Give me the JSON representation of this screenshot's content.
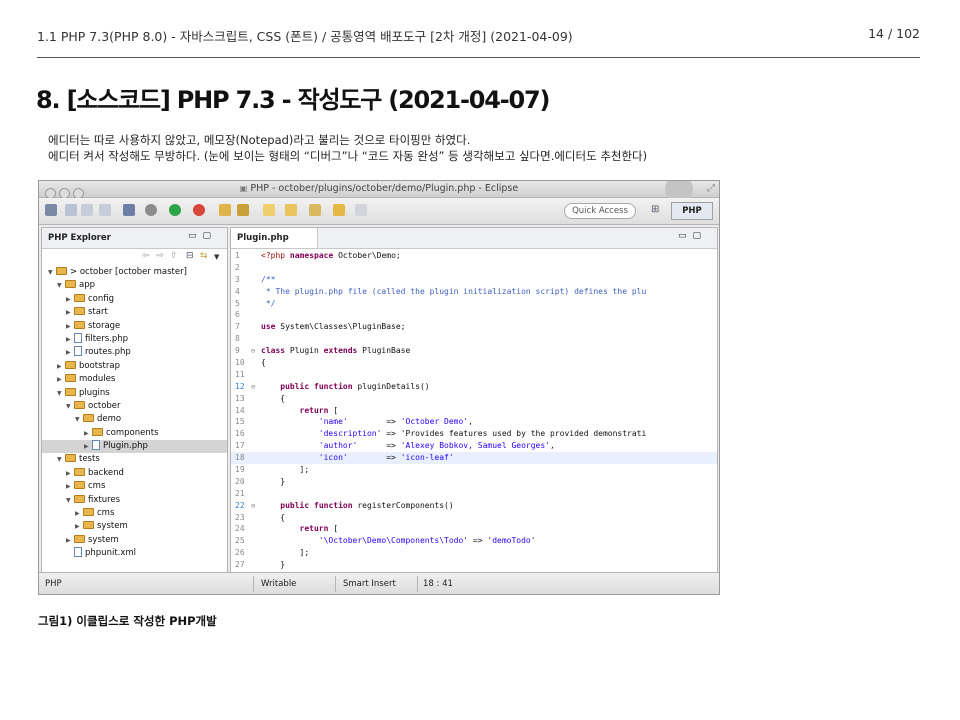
{
  "header": {
    "breadcrumb": "1.1 PHP 7.3(PHP 8.0) - 자바스크립트, CSS (폰트) / 공통영역 배포도구 [2차 개정] (2021-04-09)",
    "page_number": "14 / 102"
  },
  "section_title": "8. [소스코드] PHP 7.3 - 작성도구 (2021-04-07)",
  "description": [
    "에디터는 따로 사용하지 않았고, 메모장(Notepad)라고 불리는 것으로 타이핑만 하였다.",
    "에디터 켜서 작성해도 무방하다. (눈에 보이는 형태의 “디버그”나 “코드 자동 완성” 등 생각해보고 싶다면.에디터도 추천한다)"
  ],
  "caption": "그림1) 이클립스로 작성한 PHP개발",
  "eclipse": {
    "window_title": "PHP - october/plugins/october/demo/Plugin.php - Eclipse",
    "quick_access": "Quick Access",
    "perspective": "PHP",
    "explorer_title": "PHP Explorer",
    "editor_tab": "Plugin.php",
    "tree": [
      {
        "label": "> october  [october master]",
        "depth": 0,
        "kind": "project",
        "open": true
      },
      {
        "label": "app",
        "depth": 1,
        "kind": "folder",
        "open": true
      },
      {
        "label": "config",
        "depth": 2,
        "kind": "folder",
        "open": false
      },
      {
        "label": "start",
        "depth": 2,
        "kind": "folder",
        "open": false
      },
      {
        "label": "storage",
        "depth": 2,
        "kind": "folder",
        "open": false
      },
      {
        "label": "filters.php",
        "depth": 2,
        "kind": "file",
        "open": false
      },
      {
        "label": "routes.php",
        "depth": 2,
        "kind": "file",
        "open": false
      },
      {
        "label": "bootstrap",
        "depth": 1,
        "kind": "folder",
        "open": false
      },
      {
        "label": "modules",
        "depth": 1,
        "kind": "folder",
        "open": false
      },
      {
        "label": "plugins",
        "depth": 1,
        "kind": "folder",
        "open": true
      },
      {
        "label": "october",
        "depth": 2,
        "kind": "folder",
        "open": true
      },
      {
        "label": "demo",
        "depth": 3,
        "kind": "folder",
        "open": true
      },
      {
        "label": "components",
        "depth": 4,
        "kind": "folder",
        "open": false
      },
      {
        "label": "Plugin.php",
        "depth": 4,
        "kind": "file",
        "open": false,
        "selected": true
      },
      {
        "label": "tests",
        "depth": 1,
        "kind": "folder",
        "open": true
      },
      {
        "label": "backend",
        "depth": 2,
        "kind": "folder",
        "open": false
      },
      {
        "label": "cms",
        "depth": 2,
        "kind": "folder",
        "open": false
      },
      {
        "label": "fixtures",
        "depth": 2,
        "kind": "folder",
        "open": true
      },
      {
        "label": "cms",
        "depth": 3,
        "kind": "folder",
        "open": false
      },
      {
        "label": "system",
        "depth": 3,
        "kind": "folder",
        "open": false
      },
      {
        "label": "system",
        "depth": 2,
        "kind": "folder",
        "open": false
      },
      {
        "label": "phpunit.xml",
        "depth": 2,
        "kind": "file",
        "open": false
      }
    ],
    "code": [
      {
        "n": "1",
        "text": "<?php namespace October\\Demo;"
      },
      {
        "n": "2",
        "text": ""
      },
      {
        "n": "3",
        "text": "/**"
      },
      {
        "n": "4",
        "text": " * The plugin.php file (called the plugin initialization script) defines the plu"
      },
      {
        "n": "5",
        "text": " */"
      },
      {
        "n": "6",
        "text": ""
      },
      {
        "n": "7",
        "text": "use System\\Classes\\PluginBase;"
      },
      {
        "n": "8",
        "text": ""
      },
      {
        "n": "9",
        "text": "class Plugin extends PluginBase",
        "marker": "⊖"
      },
      {
        "n": "10",
        "text": "{"
      },
      {
        "n": "11",
        "text": ""
      },
      {
        "n": "12",
        "text": "    public function pluginDetails()",
        "marker": "⊖",
        "mark": true
      },
      {
        "n": "13",
        "text": "    {"
      },
      {
        "n": "14",
        "text": "        return ["
      },
      {
        "n": "15",
        "text": "            'name'        => 'October Demo',"
      },
      {
        "n": "16",
        "text": "            'description' => 'Provides features used by the provided demonstrati"
      },
      {
        "n": "17",
        "text": "            'author'      => 'Alexey Bobkov, Samuel Georges',"
      },
      {
        "n": "18",
        "text": "            'icon'        => 'icon-leaf'",
        "highlight": true
      },
      {
        "n": "19",
        "text": "        ];"
      },
      {
        "n": "20",
        "text": "    }"
      },
      {
        "n": "21",
        "text": ""
      },
      {
        "n": "22",
        "text": "    public function registerComponents()",
        "marker": "⊖",
        "mark": true
      },
      {
        "n": "23",
        "text": "    {"
      },
      {
        "n": "24",
        "text": "        return ["
      },
      {
        "n": "25",
        "text": "            '\\October\\Demo\\Components\\Todo' => 'demoTodo'"
      },
      {
        "n": "26",
        "text": "        ];"
      },
      {
        "n": "27",
        "text": "    }"
      }
    ],
    "status": {
      "left": "PHP",
      "writable": "Writable",
      "insert_mode": "Smart Insert",
      "position": "18 : 41"
    }
  },
  "colors": {
    "keyword": "#7f0055",
    "string": "#2a00ff",
    "comment": "#3f5fbf",
    "php_tag": "#a01010"
  }
}
